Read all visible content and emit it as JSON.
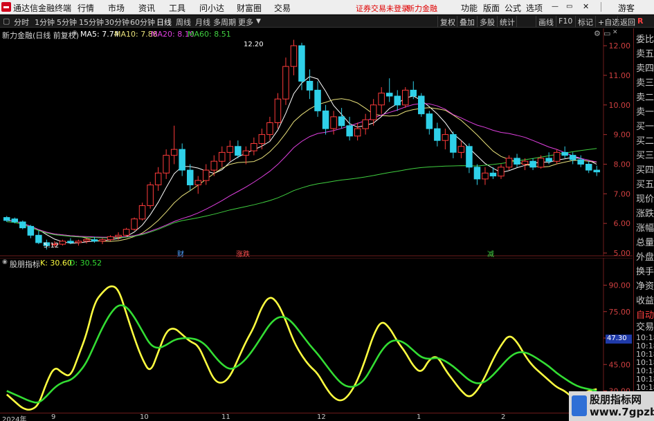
{
  "titlebar": {
    "app_name": "通达信金融终端",
    "menus": [
      "行情",
      "市场",
      "资讯",
      "工具",
      "问小达",
      "财富圈",
      "交易"
    ],
    "warning": "证券交易未登录",
    "broker": "新力金融",
    "right_menus": [
      "功能",
      "版面",
      "公式",
      "选项"
    ],
    "guest": "游客"
  },
  "toolbar": {
    "periods": [
      "分时",
      "1分钟",
      "5分钟",
      "15分钟",
      "30分钟",
      "60分钟",
      "日线",
      "周线",
      "月线",
      "多周期",
      "更多"
    ],
    "active_period": "日线",
    "right_buttons": [
      "复权",
      "叠加",
      "多股",
      "统计",
      "画线",
      "F10",
      "标记",
      "+自选",
      "返回"
    ]
  },
  "main_chart": {
    "stock_label": "新力金融(日线 前复权)",
    "ma": [
      {
        "label": "MA5: 7.74",
        "color": "#ffffff"
      },
      {
        "label": "MA10: 7.88",
        "color": "#e8e07a"
      },
      {
        "label": "MA20: 8.10",
        "color": "#e040e0"
      },
      {
        "label": "MA60: 8.51",
        "color": "#40d040"
      }
    ],
    "y_ticks": [
      "12.00",
      "11.00",
      "10.00",
      "9.00",
      "8.00",
      "7.00",
      "6.00",
      "5.00"
    ],
    "high_label": "12.20",
    "low_label": "5.12",
    "markers": [
      {
        "text": "财",
        "color": "#4fa0ff"
      },
      {
        "text": "涨跌",
        "color": "#ff5050"
      },
      {
        "text": "减",
        "color": "#40d040"
      }
    ]
  },
  "indicator": {
    "name": "股朋指标",
    "k_label": "K: 30.60",
    "d_label": "D: 30.52",
    "y_ticks": [
      "90.00",
      "75.00",
      "60.00",
      "45.00",
      "30.00"
    ],
    "cursor_value": "47.30"
  },
  "time_axis": [
    "2024年",
    "9",
    "10",
    "11",
    "12",
    "1",
    "2"
  ],
  "right_panel": {
    "items": [
      "委比",
      "卖五",
      "卖四",
      "卖三",
      "卖二",
      "卖一",
      "买一",
      "买二",
      "买三",
      "买四",
      "买五",
      "现价",
      "涨跌",
      "涨幅",
      "总量",
      "外盘",
      "换手",
      "净资",
      "收益"
    ],
    "auto_label": "自动",
    "trade_label": "交易",
    "times": [
      "10:18",
      "10:18",
      "10:18",
      "10:18",
      "10:18",
      "10:18",
      "10:18",
      "10:18",
      "10:18",
      "10:18",
      "10:18",
      "10:18",
      "10:18"
    ]
  },
  "watermark": {
    "line1": "股朋指标网",
    "line2": "www.7gpzb.com"
  },
  "colors": {
    "up": "#ff3b3b",
    "down": "#2fd0e8",
    "k_line": "#ffff40",
    "d_line": "#33dd33",
    "grid_red": "#6e1b1b"
  },
  "chart_data": [
    {
      "type": "candlestick",
      "ylim": [
        5.0,
        12.4
      ],
      "ohlc": [
        [
          6.2,
          6.25,
          6.05,
          6.1
        ],
        [
          6.15,
          6.2,
          6.0,
          6.05
        ],
        [
          6.05,
          6.1,
          5.8,
          5.85
        ],
        [
          5.9,
          5.95,
          5.5,
          5.6
        ],
        [
          5.6,
          5.75,
          5.3,
          5.35
        ],
        [
          5.35,
          5.45,
          5.12,
          5.25
        ],
        [
          5.3,
          5.4,
          5.2,
          5.3
        ],
        [
          5.3,
          5.45,
          5.25,
          5.4
        ],
        [
          5.4,
          5.5,
          5.3,
          5.35
        ],
        [
          5.35,
          5.45,
          5.25,
          5.4
        ],
        [
          5.4,
          5.5,
          5.32,
          5.45
        ],
        [
          5.45,
          5.55,
          5.35,
          5.4
        ],
        [
          5.4,
          5.5,
          5.3,
          5.45
        ],
        [
          5.45,
          5.6,
          5.4,
          5.55
        ],
        [
          5.55,
          5.7,
          5.45,
          5.6
        ],
        [
          5.6,
          5.85,
          5.55,
          5.8
        ],
        [
          5.8,
          6.2,
          5.75,
          6.15
        ],
        [
          6.15,
          6.7,
          6.1,
          6.6
        ],
        [
          6.6,
          7.4,
          6.5,
          7.3
        ],
        [
          7.3,
          7.9,
          7.1,
          7.7
        ],
        [
          7.7,
          8.5,
          7.5,
          8.3
        ],
        [
          8.3,
          9.3,
          8.0,
          8.5
        ],
        [
          8.5,
          8.7,
          7.6,
          7.8
        ],
        [
          7.8,
          8.0,
          7.1,
          7.3
        ],
        [
          7.3,
          7.6,
          7.0,
          7.45
        ],
        [
          7.45,
          8.0,
          7.3,
          7.8
        ],
        [
          7.8,
          8.3,
          7.6,
          8.1
        ],
        [
          8.1,
          8.6,
          7.9,
          8.4
        ],
        [
          8.4,
          8.8,
          8.1,
          8.6
        ],
        [
          8.6,
          8.8,
          8.2,
          8.3
        ],
        [
          8.3,
          8.6,
          8.0,
          8.45
        ],
        [
          8.45,
          8.9,
          8.3,
          8.7
        ],
        [
          8.7,
          9.2,
          8.5,
          9.0
        ],
        [
          9.0,
          9.6,
          8.8,
          9.4
        ],
        [
          9.4,
          10.4,
          9.2,
          10.2
        ],
        [
          10.2,
          11.6,
          10.0,
          11.3
        ],
        [
          11.3,
          12.2,
          11.0,
          12.0
        ],
        [
          12.0,
          12.1,
          10.5,
          10.8
        ],
        [
          10.8,
          11.2,
          10.2,
          10.5
        ],
        [
          10.5,
          10.8,
          9.6,
          9.8
        ],
        [
          9.8,
          10.0,
          9.0,
          9.2
        ],
        [
          9.2,
          9.8,
          9.0,
          9.6
        ],
        [
          9.6,
          9.9,
          9.2,
          9.3
        ],
        [
          9.3,
          9.6,
          8.8,
          8.95
        ],
        [
          8.95,
          9.4,
          8.8,
          9.2
        ],
        [
          9.2,
          9.7,
          9.0,
          9.5
        ],
        [
          9.5,
          10.2,
          9.3,
          10.0
        ],
        [
          10.0,
          10.6,
          9.7,
          10.4
        ],
        [
          10.4,
          10.9,
          10.1,
          10.3
        ],
        [
          10.3,
          10.5,
          9.8,
          10.0
        ],
        [
          10.0,
          10.6,
          9.9,
          10.5
        ],
        [
          10.5,
          10.8,
          10.2,
          10.3
        ],
        [
          10.3,
          10.4,
          9.6,
          9.7
        ],
        [
          9.7,
          9.8,
          9.0,
          9.2
        ],
        [
          9.2,
          9.4,
          8.6,
          8.8
        ],
        [
          8.8,
          9.2,
          8.5,
          9.0
        ],
        [
          9.0,
          9.1,
          8.2,
          8.4
        ],
        [
          8.4,
          8.8,
          8.2,
          8.6
        ],
        [
          8.6,
          8.7,
          7.7,
          7.9
        ],
        [
          7.9,
          8.0,
          7.3,
          7.5
        ],
        [
          7.5,
          7.9,
          7.3,
          7.7
        ],
        [
          7.7,
          7.9,
          7.5,
          7.6
        ],
        [
          7.6,
          8.0,
          7.5,
          7.9
        ],
        [
          7.9,
          8.3,
          7.8,
          8.2
        ],
        [
          8.2,
          8.35,
          7.9,
          8.0
        ],
        [
          8.0,
          8.2,
          7.8,
          8.1
        ],
        [
          8.1,
          8.2,
          7.8,
          7.9
        ],
        [
          7.9,
          8.3,
          7.85,
          8.2
        ],
        [
          8.2,
          8.4,
          8.0,
          8.1
        ],
        [
          8.1,
          8.5,
          8.0,
          8.4
        ],
        [
          8.4,
          8.6,
          8.2,
          8.3
        ],
        [
          8.3,
          8.4,
          8.0,
          8.15
        ],
        [
          8.15,
          8.3,
          7.9,
          8.0
        ],
        [
          8.0,
          8.1,
          7.7,
          7.8
        ],
        [
          7.8,
          7.95,
          7.6,
          7.74
        ]
      ],
      "ma_series": [
        {
          "name": "MA5",
          "color": "#ffffff"
        },
        {
          "name": "MA10",
          "color": "#e8e07a"
        },
        {
          "name": "MA20",
          "color": "#e040e0"
        },
        {
          "name": "MA60",
          "color": "#40d040"
        }
      ]
    },
    {
      "type": "line",
      "ylim": [
        20,
        100
      ],
      "series": [
        {
          "name": "K",
          "color": "#ffff40",
          "values": [
            28,
            24,
            20,
            19,
            22,
            35,
            44,
            40,
            38,
            50,
            62,
            80,
            86,
            90,
            88,
            74,
            60,
            48,
            40,
            52,
            64,
            66,
            62,
            58,
            56,
            46,
            36,
            34,
            38,
            48,
            58,
            66,
            78,
            84,
            80,
            70,
            58,
            50,
            44,
            40,
            32,
            26,
            24,
            28,
            36,
            48,
            62,
            70,
            66,
            58,
            52,
            44,
            40,
            48,
            50,
            42,
            36,
            30,
            26,
            30,
            38,
            48,
            56,
            62,
            58,
            50,
            44,
            40,
            36,
            32,
            30,
            26,
            28,
            30,
            31
          ]
        },
        {
          "name": "D",
          "color": "#33dd33",
          "values": [
            30,
            28,
            26,
            24,
            23,
            27,
            32,
            35,
            36,
            40,
            46,
            56,
            66,
            74,
            79,
            78,
            72,
            64,
            56,
            54,
            56,
            59,
            60,
            60,
            59,
            56,
            50,
            45,
            42,
            44,
            48,
            54,
            61,
            68,
            72,
            72,
            68,
            62,
            56,
            51,
            45,
            39,
            34,
            32,
            33,
            37,
            45,
            53,
            58,
            59,
            57,
            53,
            49,
            48,
            49,
            47,
            44,
            40,
            36,
            34,
            35,
            39,
            44,
            49,
            52,
            52,
            50,
            47,
            44,
            40,
            37,
            34,
            32,
            31,
            30
          ]
        }
      ]
    }
  ]
}
